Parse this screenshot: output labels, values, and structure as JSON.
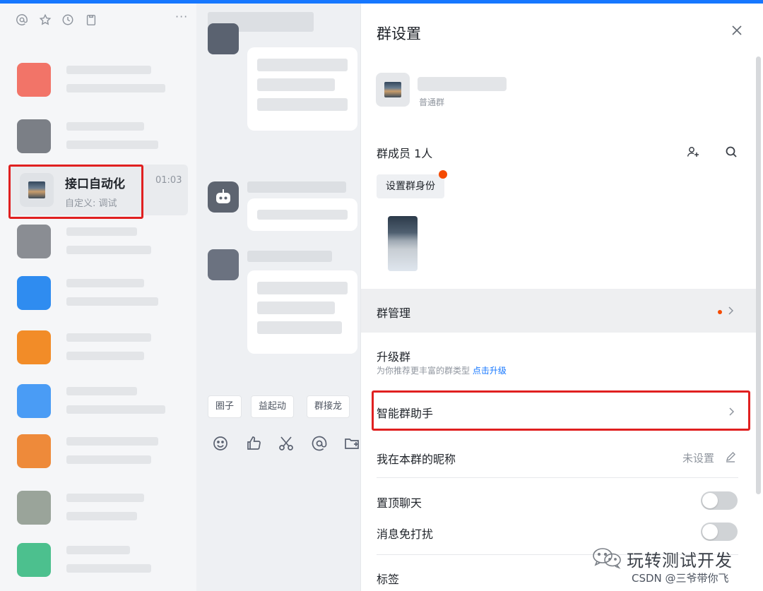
{
  "left_panel": {
    "active_chat": {
      "name": "接口自动化",
      "subtitle": "自定义: 调试",
      "time": "01:03"
    }
  },
  "middle_panel": {
    "quick_actions": [
      "圈子",
      "益起动",
      "群接龙"
    ]
  },
  "settings": {
    "title": "群设置",
    "group_type": "普通群",
    "members_label": "群成员 1人",
    "set_role_label": "设置群身份",
    "manage_label": "群管理",
    "upgrade_label": "升级群",
    "upgrade_desc": "为你推荐更丰富的群类型",
    "upgrade_link": "点击升级",
    "assistant_label": "智能群助手",
    "nickname_label": "我在本群的昵称",
    "nickname_value": "未设置",
    "pin_label": "置顶聊天",
    "mute_label": "消息免打扰",
    "tag_label": "标签"
  },
  "toggles": {
    "pin_on": false,
    "mute_on": false
  },
  "colors": {
    "accent": "#1677ff",
    "highlight": "#e02020",
    "badge": "#f54a00"
  },
  "watermark": {
    "channel_name": "玩转测试开发",
    "credit": "CSDN @三爷带你飞"
  }
}
